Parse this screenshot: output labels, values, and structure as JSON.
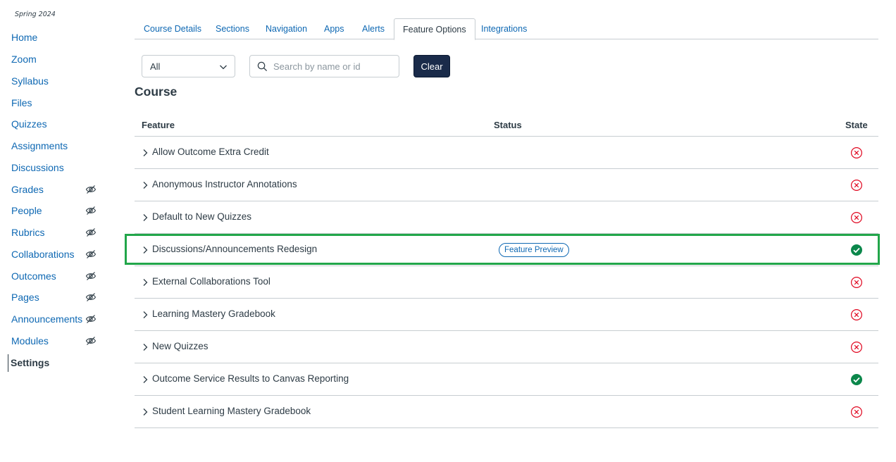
{
  "term": "Spring 2024",
  "nav": [
    {
      "label": "Home",
      "hidden": false,
      "active": false
    },
    {
      "label": "Zoom",
      "hidden": false,
      "active": false
    },
    {
      "label": "Syllabus",
      "hidden": false,
      "active": false
    },
    {
      "label": "Files",
      "hidden": false,
      "active": false
    },
    {
      "label": "Quizzes",
      "hidden": false,
      "active": false
    },
    {
      "label": "Assignments",
      "hidden": false,
      "active": false
    },
    {
      "label": "Discussions",
      "hidden": false,
      "active": false
    },
    {
      "label": "Grades",
      "hidden": true,
      "active": false
    },
    {
      "label": "People",
      "hidden": true,
      "active": false
    },
    {
      "label": "Rubrics",
      "hidden": true,
      "active": false
    },
    {
      "label": "Collaborations",
      "hidden": true,
      "active": false
    },
    {
      "label": "Outcomes",
      "hidden": true,
      "active": false
    },
    {
      "label": "Pages",
      "hidden": true,
      "active": false
    },
    {
      "label": "Announcements",
      "hidden": true,
      "active": false
    },
    {
      "label": "Modules",
      "hidden": true,
      "active": false
    },
    {
      "label": "Settings",
      "hidden": false,
      "active": true
    }
  ],
  "tabs": [
    {
      "label": "Course Details"
    },
    {
      "label": "Sections"
    },
    {
      "label": "Navigation"
    },
    {
      "label": "Apps"
    },
    {
      "label": "Alerts"
    },
    {
      "label": "Feature Options",
      "active": true
    },
    {
      "label": "Integrations"
    }
  ],
  "filter": {
    "select_value": "All",
    "search_placeholder": "Search by name or id",
    "clear_label": "Clear"
  },
  "section_title": "Course",
  "table": {
    "headers": {
      "feature": "Feature",
      "status": "Status",
      "state": "State"
    },
    "rows": [
      {
        "name": "Allow Outcome Extra Credit",
        "status": "",
        "state": "off"
      },
      {
        "name": "Anonymous Instructor Annotations",
        "status": "",
        "state": "off"
      },
      {
        "name": "Default to New Quizzes",
        "status": "",
        "state": "off"
      },
      {
        "name": "Discussions/Announcements Redesign",
        "status": "Feature Preview",
        "state": "on"
      },
      {
        "name": "External Collaborations Tool",
        "status": "",
        "state": "off"
      },
      {
        "name": "Learning Mastery Gradebook",
        "status": "",
        "state": "off"
      },
      {
        "name": "New Quizzes",
        "status": "",
        "state": "off"
      },
      {
        "name": "Outcome Service Results to Canvas Reporting",
        "status": "",
        "state": "on"
      },
      {
        "name": "Student Learning Mastery Gradebook",
        "status": "",
        "state": "off"
      }
    ]
  },
  "colors": {
    "link": "#0e68b3",
    "on": "#0b874b",
    "off": "#e0061f",
    "highlight": "#22a64a",
    "button": "#1a2b4a"
  },
  "icons": {
    "hidden": "eye-slash-icon",
    "on": "check-circle-icon",
    "off": "x-circle-icon",
    "expand": "chevron-right-icon",
    "search": "search-icon",
    "dropdown": "chevron-down-icon"
  }
}
